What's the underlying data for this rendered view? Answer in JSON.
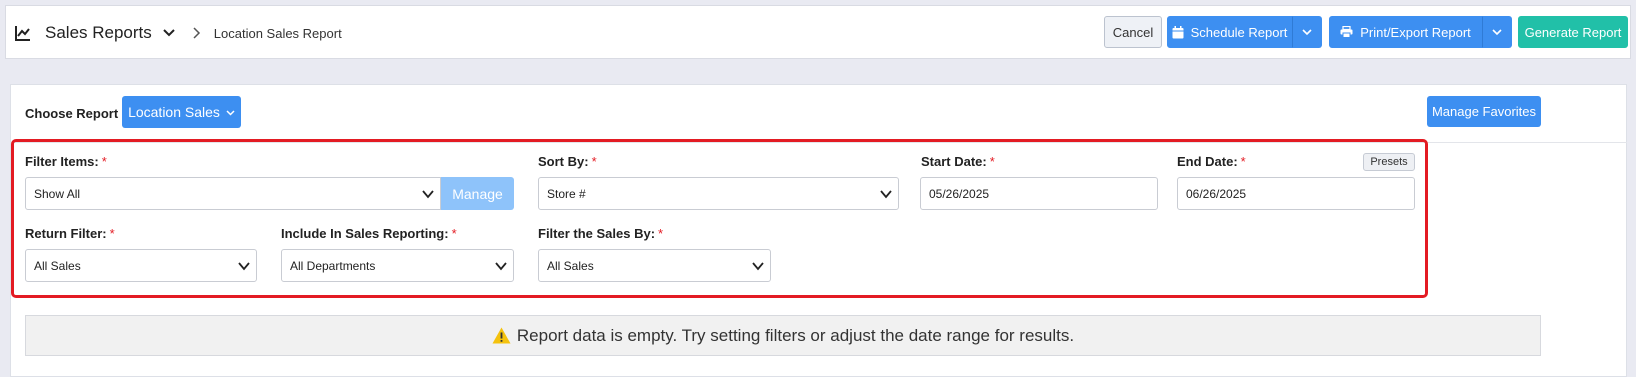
{
  "header": {
    "app_title": "Sales Reports",
    "breadcrumb": "Location Sales Report",
    "cancel_label": "Cancel",
    "schedule_label": "Schedule Report",
    "print_label": "Print/Export Report",
    "generate_label": "Generate Report"
  },
  "report": {
    "choose_label": "Choose Report",
    "selected": "Location Sales",
    "favorites_label": "Manage Favorites"
  },
  "filters": {
    "filter_items": {
      "label": "Filter Items:",
      "value": "Show All",
      "manage_label": "Manage"
    },
    "sort_by": {
      "label": "Sort By:",
      "value": "Store #"
    },
    "start_date": {
      "label": "Start Date:",
      "value": "05/26/2025"
    },
    "end_date": {
      "label": "End Date:",
      "value": "06/26/2025",
      "presets_label": "Presets"
    },
    "return_filter": {
      "label": "Return Filter:",
      "value": "All Sales"
    },
    "include_in_sales": {
      "label": "Include In Sales Reporting:",
      "value": "All Departments"
    },
    "filter_sales_by": {
      "label": "Filter the Sales By:",
      "value": "All Sales"
    },
    "required_marker": "*"
  },
  "message": {
    "empty": "Report data is empty. Try setting filters or adjust the date range for results."
  },
  "colors": {
    "primary": "#3d8ff1",
    "generate": "#21c0a8",
    "highlight": "#e31b23",
    "warning": "#f4c20d"
  }
}
